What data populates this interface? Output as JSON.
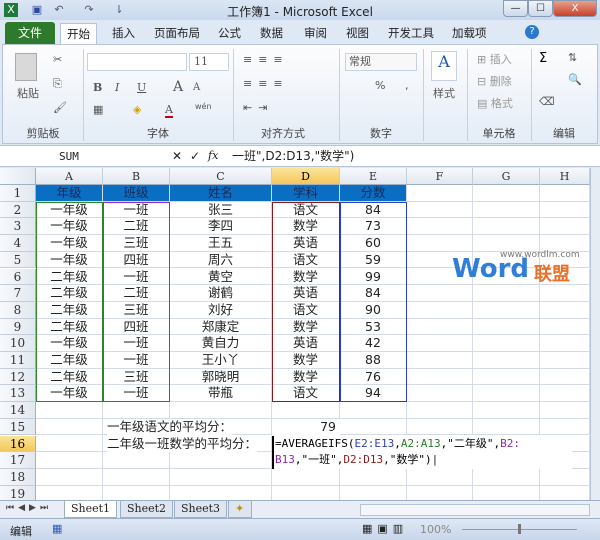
{
  "window": {
    "title": "工作簿1 - Microsoft Excel",
    "min": "—",
    "max": "☐",
    "close": "X"
  },
  "quick_access": {
    "excel_icon": "excel-icon",
    "save_icon": "save-icon",
    "undo": "↶",
    "redo": "↷",
    "customize": "⇂"
  },
  "tabs": [
    "文件",
    "开始",
    "插入",
    "页面布局",
    "公式",
    "数据",
    "审阅",
    "视图",
    "开发工具",
    "加载项"
  ],
  "ribbon": {
    "clipboard": {
      "paste": "粘贴",
      "label": "剪贴板"
    },
    "font": {
      "size": "11",
      "bold": "B",
      "italic": "I",
      "underline": "U",
      "grow": "A",
      "shrink": "A",
      "color": "A",
      "wen": "wén",
      "label": "字体"
    },
    "align": {
      "label": "对齐方式"
    },
    "number": {
      "format": "常规",
      "percent": "%",
      "comma": ",",
      "label": "数字"
    },
    "styles": {
      "label": "样式"
    },
    "cells": {
      "insert": "插入",
      "delete": "删除",
      "format": "格式",
      "label": "单元格"
    },
    "editing": {
      "sum": "Σ",
      "label": "编辑"
    }
  },
  "formula_bar": {
    "name_box": "SUM",
    "cancel": "✕",
    "enter": "✓",
    "fx": "fx",
    "content": "一班\",D2:D13,\"数学\")"
  },
  "columns": [
    "A",
    "B",
    "C",
    "D",
    "E",
    "F",
    "G",
    "H"
  ],
  "selected_column": "D",
  "selected_row": 16,
  "table": {
    "header": [
      "年级",
      "班级",
      "姓名",
      "学科",
      "分数"
    ],
    "rows": [
      [
        "一年级",
        "一班",
        "张三",
        "语文",
        "84"
      ],
      [
        "一年级",
        "二班",
        "李四",
        "数学",
        "73"
      ],
      [
        "一年级",
        "三班",
        "王五",
        "英语",
        "60"
      ],
      [
        "一年级",
        "四班",
        "周六",
        "语文",
        "59"
      ],
      [
        "二年级",
        "一班",
        "黄空",
        "数学",
        "99"
      ],
      [
        "二年级",
        "二班",
        "谢鹤",
        "英语",
        "84"
      ],
      [
        "二年级",
        "三班",
        "刘好",
        "语文",
        "90"
      ],
      [
        "二年级",
        "四班",
        "郑康定",
        "数学",
        "53"
      ],
      [
        "一年级",
        "一班",
        "黄自力",
        "英语",
        "42"
      ],
      [
        "二年级",
        "一班",
        "王小丫",
        "数学",
        "88"
      ],
      [
        "二年级",
        "三班",
        "郭晓明",
        "数学",
        "76"
      ],
      [
        "一年级",
        "一班",
        "带瓶",
        "语文",
        "94"
      ]
    ]
  },
  "summary": {
    "label1": "一年级语文的平均分：",
    "value1": "79",
    "label2": "二年级一班数学的平均分：",
    "formula_line1": [
      {
        "t": "=AVERAGEIFS(",
        "c": "#000"
      },
      {
        "t": "E2:E13",
        "c": "#2c3fb8"
      },
      {
        "t": ",",
        "c": "#000"
      },
      {
        "t": "A2:A13",
        "c": "#2a7a2a"
      },
      {
        "t": ",\"二年级\",",
        "c": "#000"
      },
      {
        "t": "B2:",
        "c": "#8a2ab0"
      }
    ],
    "formula_line2": [
      {
        "t": "B13",
        "c": "#8a2ab0"
      },
      {
        "t": ",\"一班\",",
        "c": "#000"
      },
      {
        "t": "D2:D13",
        "c": "#8b1a1a"
      },
      {
        "t": ",\"数学\")",
        "c": "#000"
      }
    ]
  },
  "range_colors": {
    "A": "#2a8a2a",
    "B": "#9a2ac8",
    "D": "#8b1a1a",
    "E": "#2c3fc8"
  },
  "watermark": {
    "url": "www.wordlm.com",
    "word": "Word",
    "cn": "联盟"
  },
  "sheets": [
    "Sheet1",
    "Sheet2",
    "Sheet3"
  ],
  "status": {
    "mode": "编辑",
    "zoom": "100%"
  }
}
